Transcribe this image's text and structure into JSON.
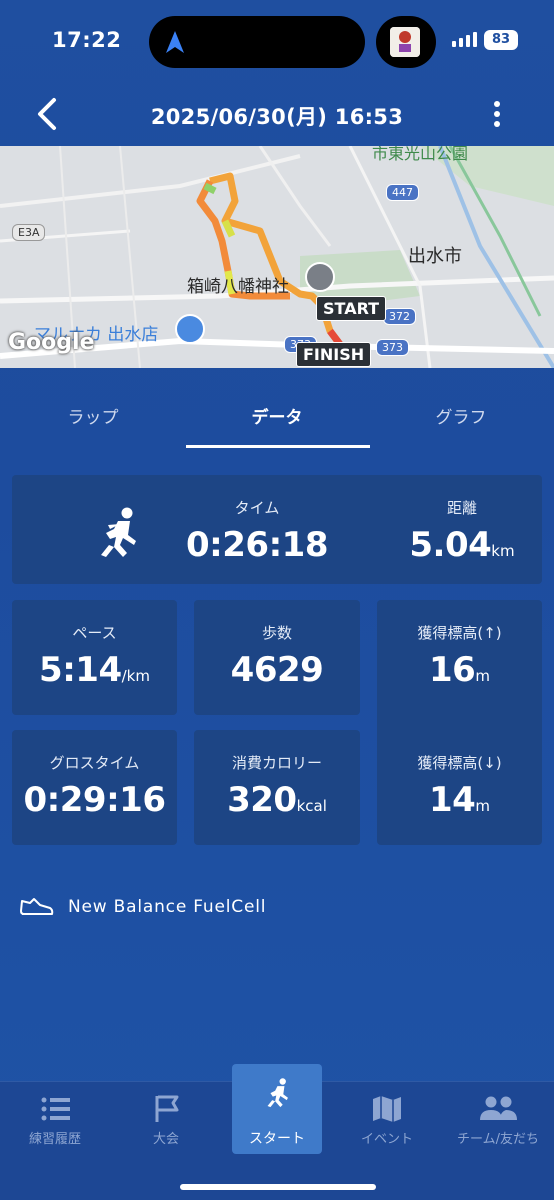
{
  "status_bar": {
    "time": "17:22",
    "battery": "83"
  },
  "header": {
    "title": "2025/06/30(月) 16:53"
  },
  "map": {
    "labels": {
      "park": "市東光山公園",
      "shrine": "箱崎八幡神社",
      "city": "出水市",
      "store": "マルナカ 出水店",
      "expressway": "E3A",
      "google": "Google"
    },
    "road_shields": [
      "447",
      "372",
      "373",
      "373"
    ],
    "start_label": "START",
    "finish_label": "FINISH"
  },
  "tabs": [
    {
      "label": "ラップ"
    },
    {
      "label": "データ"
    },
    {
      "label": "グラフ"
    }
  ],
  "stats": {
    "time": {
      "label": "タイム",
      "value": "0:26:18"
    },
    "distance": {
      "label": "距離",
      "value": "5.04",
      "unit": "km"
    },
    "pace": {
      "label": "ペース",
      "value": "5:14",
      "unit": "/km"
    },
    "steps": {
      "label": "歩数",
      "value": "4629"
    },
    "elev_up": {
      "label": "獲得標高(↑)",
      "value": "16",
      "unit": "m"
    },
    "gross_time": {
      "label": "グロスタイム",
      "value": "0:29:16"
    },
    "calories": {
      "label": "消費カロリー",
      "value": "320",
      "unit": "kcal"
    },
    "elev_down": {
      "label": "獲得標高(↓)",
      "value": "14",
      "unit": "m"
    }
  },
  "shoe": {
    "name": "New Balance FuelCell"
  },
  "bottom_nav": [
    {
      "label": "練習履歴"
    },
    {
      "label": "大会"
    },
    {
      "label": "スタート"
    },
    {
      "label": "イベント"
    },
    {
      "label": "チーム/友だち"
    }
  ]
}
